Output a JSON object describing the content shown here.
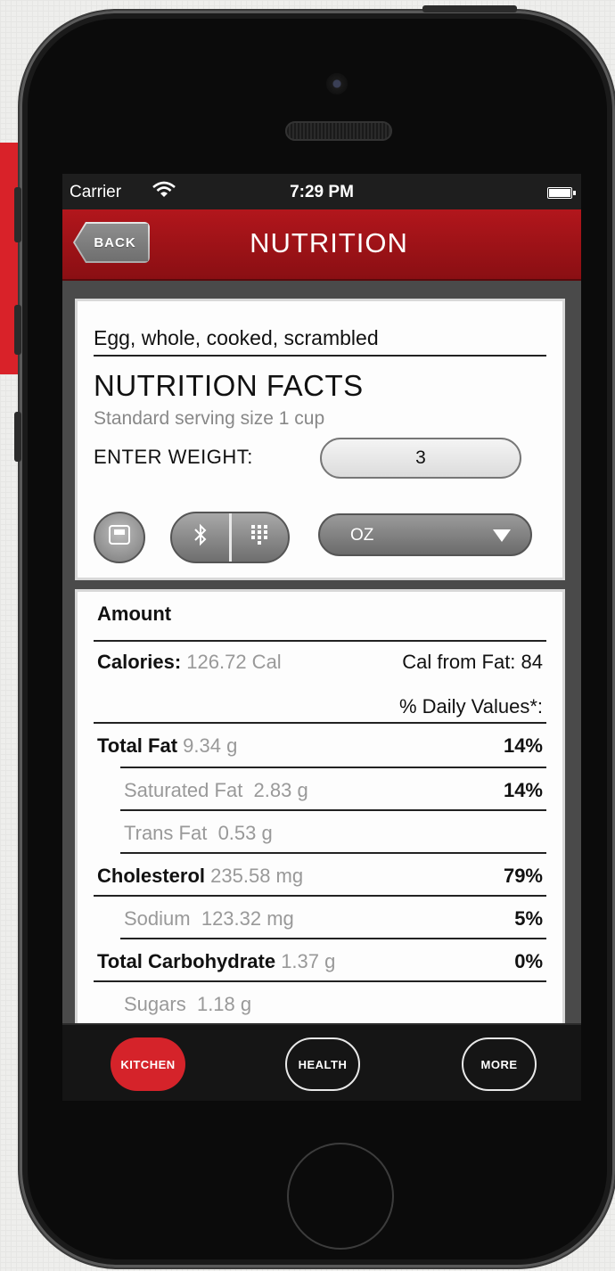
{
  "status_bar": {
    "carrier": "Carrier",
    "time": "7:29 PM"
  },
  "nav": {
    "back_label": "BACK",
    "title": "NUTRITION"
  },
  "food": {
    "name": "Egg, whole, cooked, scrambled",
    "facts_title": "NUTRITION FACTS",
    "serving": "Standard serving size 1 cup",
    "enter_weight_label": "ENTER WEIGHT:",
    "weight_value": "3",
    "unit": "OZ"
  },
  "nutrition": {
    "amount_header": "Amount",
    "calories_label": "Calories:",
    "calories_value": "126.72 Cal",
    "cal_from_fat": "Cal from Fat: 84",
    "daily_values_label": "% Daily Values*:",
    "rows": [
      {
        "label": "Total Fat",
        "value": "9.34 g",
        "pct": "14%"
      },
      {
        "label": "Saturated Fat",
        "value": "2.83 g",
        "pct": "14%"
      },
      {
        "label": "Trans Fat",
        "value": "0.53 g",
        "pct": ""
      },
      {
        "label": "Cholesterol",
        "value": "235.58 mg",
        "pct": "79%"
      },
      {
        "label": "Sodium",
        "value": "123.32 mg",
        "pct": "5%"
      },
      {
        "label": "Total Carbohydrate",
        "value": "1.37 g",
        "pct": "0%"
      },
      {
        "label": "Sugars",
        "value": "1.18 g",
        "pct": ""
      }
    ]
  },
  "tabs": [
    {
      "label": "KITCHEN",
      "active": true
    },
    {
      "label": "HEALTH",
      "active": false
    },
    {
      "label": "MORE",
      "active": false
    }
  ],
  "icons": {
    "wifi": "wifi-icon",
    "battery": "battery-icon",
    "scale": "scale-icon",
    "bluetooth": "bluetooth-icon",
    "keypad": "keypad-icon",
    "dropdown": "chevron-down-icon"
  },
  "colors": {
    "accent_red": "#d5232a",
    "nav_red": "#a3141a"
  }
}
